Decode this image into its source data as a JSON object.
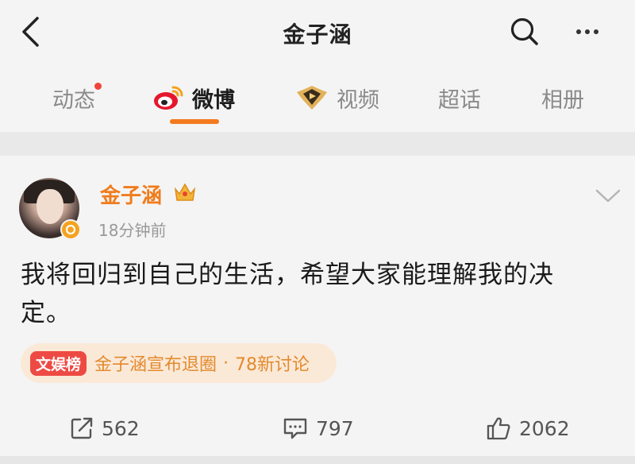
{
  "header": {
    "title": "金子涵",
    "back_icon": "chevron-left-icon",
    "search_icon": "search-icon",
    "more_icon": "more-horizontal-icon"
  },
  "tabs": [
    {
      "label": "动态",
      "has_dot": true
    },
    {
      "label": "微博",
      "icon": "weibo-logo-icon",
      "active": true
    },
    {
      "label": "视频",
      "icon": "video-badge-icon"
    },
    {
      "label": "超话"
    },
    {
      "label": "相册"
    }
  ],
  "post": {
    "author": "金子涵",
    "time": "18分钟前",
    "text": "我将回归到自己的生活，希望大家能理解我的决定。",
    "topic": {
      "tag": "文娱榜",
      "title": "金子涵宣布退圈",
      "separator": "·",
      "count": "78新讨论"
    },
    "actions": {
      "repost": "562",
      "comments": "797",
      "likes": "2062"
    }
  },
  "colors": {
    "accent": "#f47a20",
    "username": "#f07c1c",
    "topic_bg": "#fbe9d8",
    "topic_tag": "#ee4a44"
  }
}
